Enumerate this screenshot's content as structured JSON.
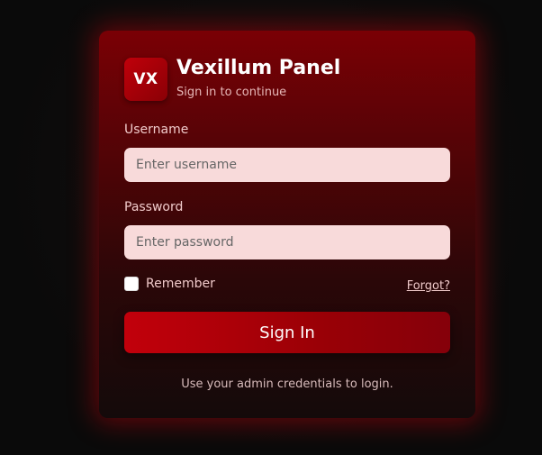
{
  "brand": {
    "logo_text": "VX",
    "title": "Vexillum Panel",
    "subtitle": "Sign in to continue"
  },
  "form": {
    "username_label": "Username",
    "username_placeholder": "Enter username",
    "username_value": "",
    "password_label": "Password",
    "password_placeholder": "Enter password",
    "password_value": "",
    "remember_label": "Remember",
    "remember_checked": false,
    "forgot_label": "Forgot?",
    "submit_label": "Sign In"
  },
  "footer": {
    "hint": "Use your admin credentials to login."
  },
  "colors": {
    "accent": "#b0000a",
    "input_background": "#f8dada",
    "page_background": "#0a0a0a"
  }
}
